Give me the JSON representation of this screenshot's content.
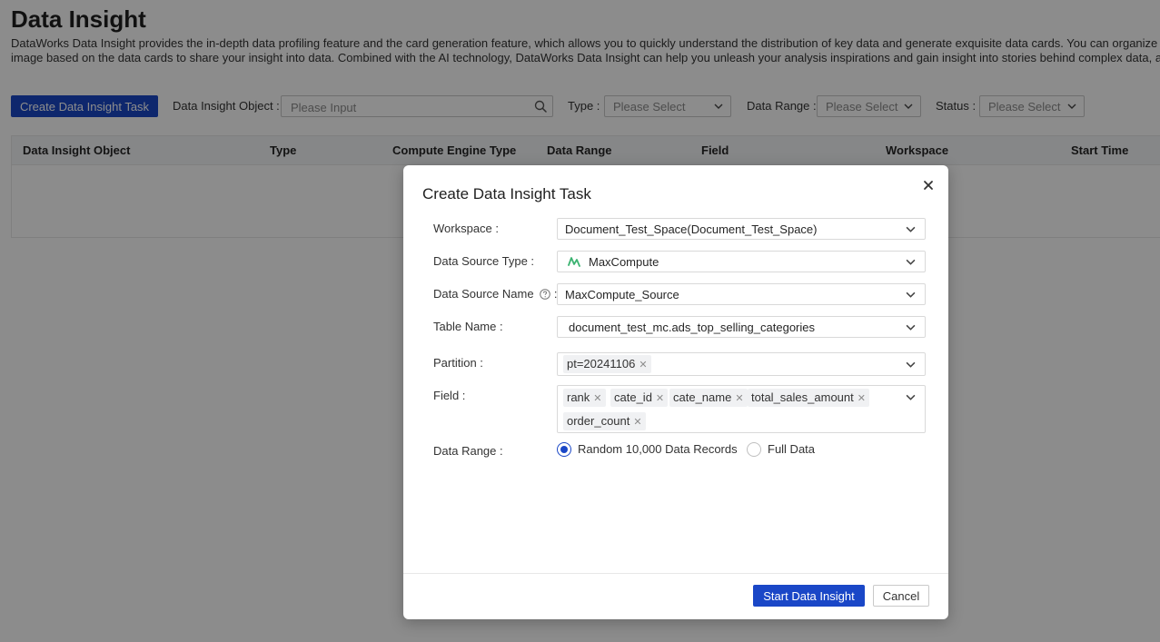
{
  "page": {
    "title": "Data Insight",
    "description_line1": "DataWorks Data Insight provides the in-depth data profiling feature and the card generation feature, which allows you to quickly understand the distribution of key data and generate exquisite data cards. You can organize the g",
    "description_line2": "image based on the data cards to share your insight into data. Combined with the AI technology, DataWorks Data Insight can help you unleash your analysis inspirations and gain insight into stories behind complex data, and driv"
  },
  "toolbar": {
    "create_button": "Create Data Insight Task",
    "object_label": "Data Insight Object :",
    "object_placeholder": "Please Input",
    "type_label": "Type :",
    "type_placeholder": "Please Select",
    "range_label": "Data Range :",
    "range_placeholder": "Please Select",
    "status_label": "Status :",
    "status_placeholder": "Please Select"
  },
  "table": {
    "columns": [
      "Data Insight Object",
      "Type",
      "Compute Engine Type",
      "Data Range",
      "Field",
      "Workspace",
      "Start Time"
    ]
  },
  "modal": {
    "title": "Create Data Insight Task",
    "workspace_label": "Workspace :",
    "workspace_value": "Document_Test_Space(Document_Test_Space)",
    "source_type_label": "Data Source Type :",
    "source_type_value": "MaxCompute",
    "source_name_label": "Data Source Name",
    "source_name_colon": ":",
    "source_name_value": "MaxCompute_Source",
    "table_label": "Table Name :",
    "table_value": "document_test_mc.ads_top_selling_categories",
    "partition_label": "Partition :",
    "partition_tags": [
      "pt=20241106"
    ],
    "field_label": "Field :",
    "field_tags": [
      "rank",
      "cate_id",
      "cate_name",
      "total_sales_amount",
      "order_count"
    ],
    "range_label": "Data Range :",
    "range_options": [
      "Random 10,000 Data Records",
      "Full Data"
    ],
    "range_selected": "Random 10,000 Data Records",
    "start_button": "Start Data Insight",
    "cancel_button": "Cancel"
  },
  "colors": {
    "primary": "#1a47c7",
    "maxcompute_icon": "#3cb371"
  }
}
